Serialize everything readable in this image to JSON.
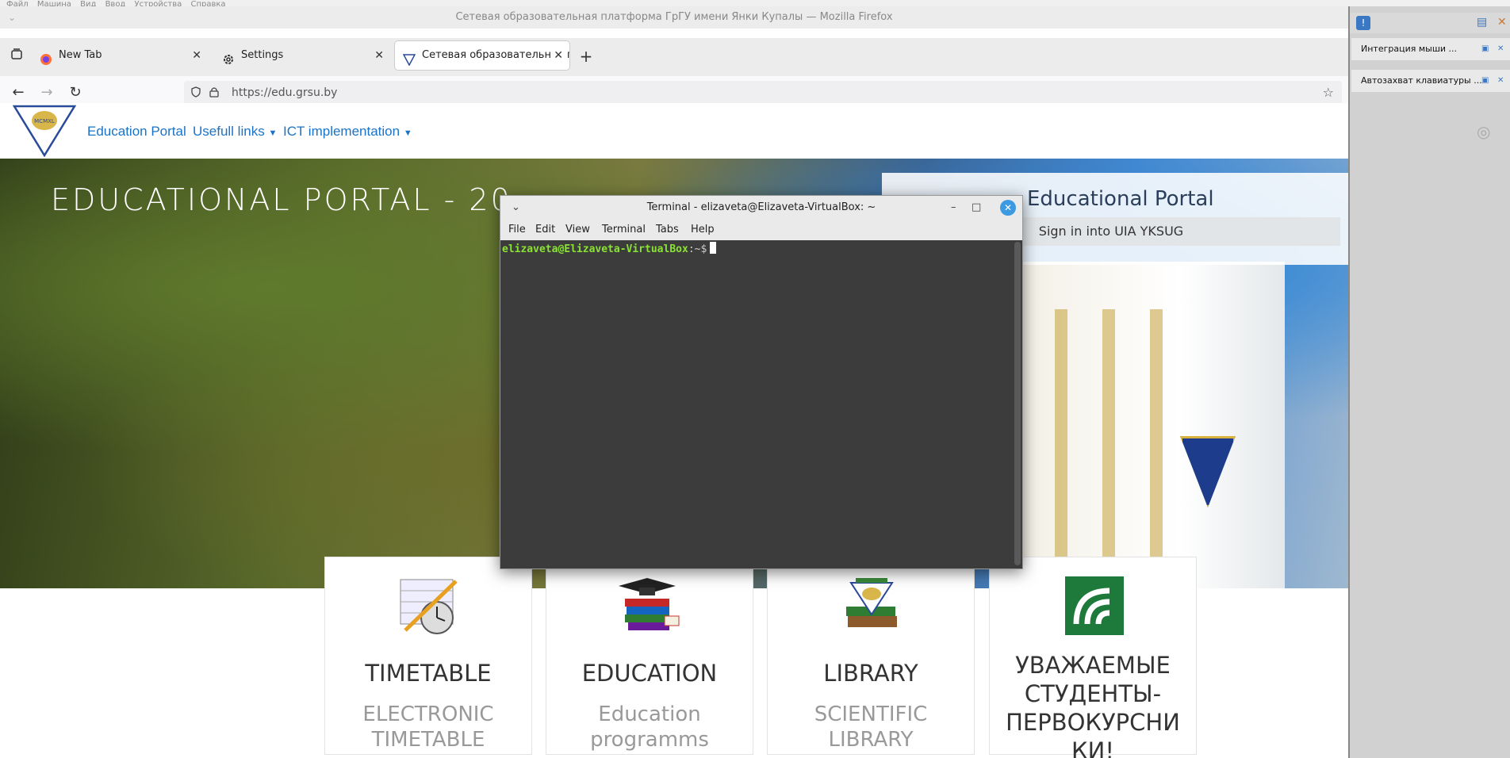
{
  "vbox_menubar": {
    "items": [
      "Файл",
      "Машина",
      "Вид",
      "Ввод",
      "Устройства",
      "Справка"
    ]
  },
  "firefox": {
    "window_title": "Сетевая образовательная платформа ГрГУ имени Янки Купалы — Mozilla Firefox",
    "tabs": [
      {
        "label": "New Tab",
        "icon": "firefox-icon"
      },
      {
        "label": "Settings",
        "icon": "gear-icon"
      },
      {
        "label": "Сетевая образовательная платф",
        "icon": "grsu-icon",
        "active": true
      }
    ],
    "url": "https://edu.grsu.by"
  },
  "site": {
    "nav": [
      "Education Portal",
      "Usefull links",
      "ICT implementation"
    ],
    "logo_text": "MCMXL",
    "hero_title": "EDUCATIONAL PORTAL - 20",
    "portal_card_title": "Educational Portal",
    "signin_label": "Sign in into UIA YKSUG",
    "cards": [
      {
        "title": "TIMETABLE",
        "subtitle_1": "ELECTRONIC",
        "subtitle_2": "TIMETABLE",
        "icon": "timetable-icon"
      },
      {
        "title": "EDUCATION",
        "subtitle_1": "Education",
        "subtitle_2": "programms",
        "icon": "graduation-books-icon"
      },
      {
        "title": "LIBRARY",
        "subtitle_1": "SCIENTIFIC",
        "subtitle_2": "LIBRARY",
        "icon": "library-books-icon"
      },
      {
        "title_1": "УВАЖАЕМЫЕ",
        "title_2": "СТУДЕНТЫ-",
        "title_3": "ПЕРВОКУРСНИ",
        "title_4": "КИ!",
        "icon": "belarusbank-logo-icon"
      }
    ]
  },
  "terminal": {
    "title": "Terminal - elizaveta@Elizaveta-VirtualBox: ~",
    "menu": [
      "File",
      "Edit",
      "View",
      "Terminal",
      "Tabs",
      "Help"
    ],
    "prompt_user": "elizaveta@Elizaveta-VirtualBox",
    "prompt_path": ":~$"
  },
  "side_panel": {
    "notifications": [
      "Интеграция мыши ...",
      "Автозахват клавиатуры ..."
    ]
  }
}
